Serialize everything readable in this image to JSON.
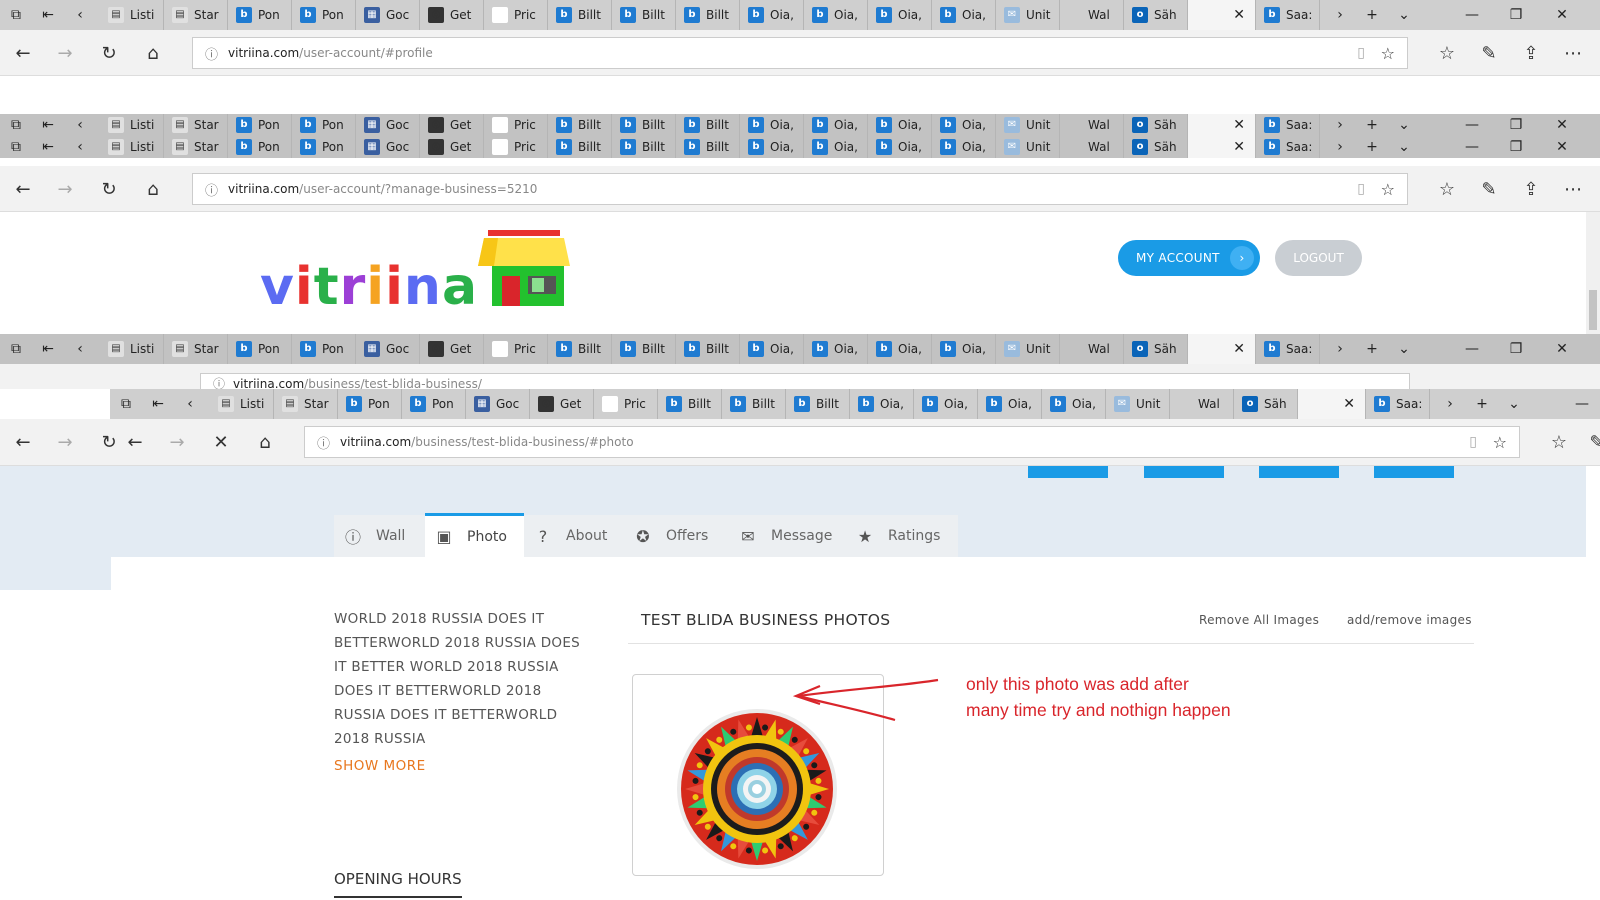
{
  "browser": {
    "tabs_a": [
      "Listi",
      "Star",
      "Pon",
      "Pon",
      "Goc",
      "Get",
      "Pric",
      "Billt",
      "Billt",
      "Billt",
      "Oia,",
      "Oia,",
      "Oia,",
      "Oia,",
      "Unit",
      "Wal",
      "Säh",
      "Saa:"
    ],
    "tabs_b": [
      "Listi",
      "Star",
      "Pon",
      "Pon",
      "Goc",
      "Get",
      "Pric",
      "Billt",
      "Billt",
      "Billt",
      "Oia,",
      "Oia,",
      "Oia,",
      "Oia,",
      "Unit",
      "Wal",
      "Säh",
      "Saa:"
    ],
    "url1_domain": "vitriina.com",
    "url1_path": "/user-account/#profile",
    "url2_domain": "vitriina.com",
    "url2_path": "/user-account/?manage-business=5210",
    "url3_domain": "vitriina.com",
    "url3_path": "/business/test-blida-business/",
    "url4_domain": "vitriina.com",
    "url4_path": "/business/test-blida-business/#photo"
  },
  "header": {
    "logo_text": "vitriina",
    "my_account": "MY ACCOUNT",
    "logout": "LOGOUT"
  },
  "profile_tabs": [
    {
      "label": "Wall",
      "icon": "info-icon"
    },
    {
      "label": "Photo",
      "icon": "image-icon"
    },
    {
      "label": "About",
      "icon": "question-icon"
    },
    {
      "label": "Offers",
      "icon": "gift-icon"
    },
    {
      "label": "Message",
      "icon": "envelope-icon"
    },
    {
      "label": "Ratings",
      "icon": "star-icon"
    }
  ],
  "sidebar": {
    "description": "WORLD 2018 RUSSIA DOES IT BETTERWORLD 2018 RUSSIA DOES IT BETTER WORLD 2018 RUSSIA DOES IT BETTERWORLD 2018 RUSSIA DOES IT BETTERWORLD 2018 RUSSIA",
    "show_more": "SHOW MORE",
    "opening_hours": "OPENING HOURS"
  },
  "photos": {
    "title": "TEST BLIDA BUSINESS PHOTOS",
    "remove_all": "Remove All Images",
    "add_remove": "add/remove images"
  },
  "annotation": {
    "note": "only this photo was add after many time try and nothign happen",
    "color": "#d9252b"
  },
  "colors": {
    "accent": "#1a9be6",
    "show_more": "#e8771e",
    "logout_bg": "#c9ced3"
  }
}
